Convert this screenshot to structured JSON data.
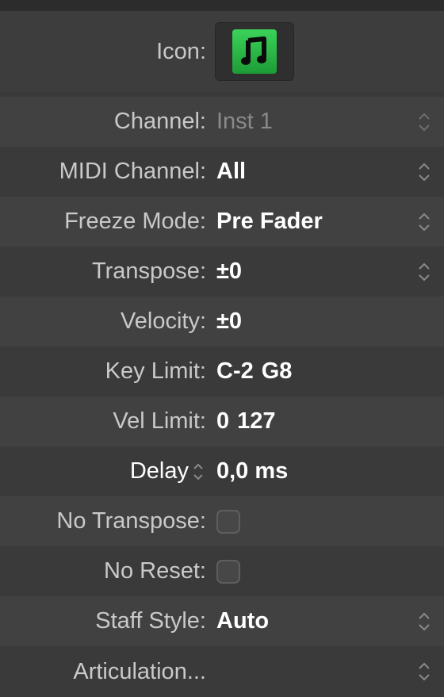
{
  "icon": {
    "label": "Icon:",
    "glyph": "music-note-icon",
    "color": "#28c445"
  },
  "rows": [
    {
      "label": "Channel:",
      "value": "Inst 1"
    },
    {
      "label": "MIDI Channel:",
      "value": "All"
    },
    {
      "label": "Freeze Mode:",
      "value": "Pre Fader"
    },
    {
      "label": "Transpose:",
      "value": "±0"
    },
    {
      "label": "Velocity:",
      "value": "±0"
    },
    {
      "label": "Key Limit:",
      "value_low": "C-2",
      "value_high": "G8"
    },
    {
      "label": "Vel Limit:",
      "value_low": "0",
      "value_high": "127"
    },
    {
      "label": "Delay",
      "value": "0,0 ms"
    },
    {
      "label": "No Transpose:",
      "checked": false
    },
    {
      "label": "No Reset:",
      "checked": false
    },
    {
      "label": "Staff Style:",
      "value": "Auto"
    },
    {
      "label": "Articulation..."
    }
  ]
}
